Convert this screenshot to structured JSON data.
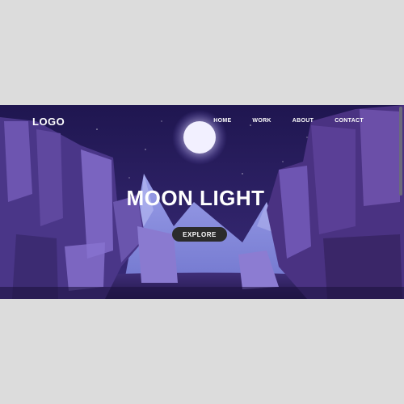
{
  "nav": {
    "logo": "LOGO",
    "items": [
      {
        "label": "HOME"
      },
      {
        "label": "WORK"
      },
      {
        "label": "ABOUT"
      },
      {
        "label": "CONTACT"
      }
    ]
  },
  "hero": {
    "title": "MOON LIGHT",
    "button_label": "EXPLORE"
  },
  "colors": {
    "sky": "#2a1e5c",
    "moon": "#f2f0ff",
    "button": "#2b2b2b",
    "text": "#ffffff"
  }
}
